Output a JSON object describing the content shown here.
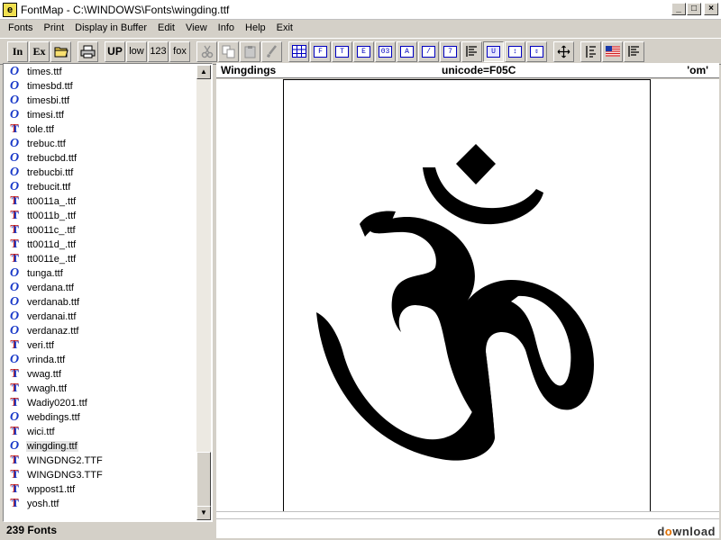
{
  "window": {
    "title": "FontMap - C:\\WINDOWS\\Fonts\\wingding.ttf",
    "app_icon_letter": "e",
    "controls": {
      "minimize": "_",
      "maximize": "□",
      "close": "×"
    }
  },
  "menu": [
    "Fonts",
    "Print",
    "Display in Buffer",
    "Edit",
    "View",
    "Info",
    "Help",
    "Exit"
  ],
  "toolbar": {
    "in_label": "In",
    "ex_label": "Ex",
    "up_label": "UP",
    "low_label": "low",
    "num_label": "123",
    "fox_label": "fox"
  },
  "font_list": [
    {
      "name": "times.ttf",
      "type": "otf"
    },
    {
      "name": "timesbd.ttf",
      "type": "otf"
    },
    {
      "name": "timesbi.ttf",
      "type": "otf"
    },
    {
      "name": "timesi.ttf",
      "type": "otf"
    },
    {
      "name": "tole.ttf",
      "type": "ttf"
    },
    {
      "name": "trebuc.ttf",
      "type": "otf"
    },
    {
      "name": "trebucbd.ttf",
      "type": "otf"
    },
    {
      "name": "trebucbi.ttf",
      "type": "otf"
    },
    {
      "name": "trebucit.ttf",
      "type": "otf"
    },
    {
      "name": "tt0011a_.ttf",
      "type": "ttf"
    },
    {
      "name": "tt0011b_.ttf",
      "type": "ttf"
    },
    {
      "name": "tt0011c_.ttf",
      "type": "ttf"
    },
    {
      "name": "tt0011d_.ttf",
      "type": "ttf"
    },
    {
      "name": "tt0011e_.ttf",
      "type": "ttf"
    },
    {
      "name": "tunga.ttf",
      "type": "otf"
    },
    {
      "name": "verdana.ttf",
      "type": "otf"
    },
    {
      "name": "verdanab.ttf",
      "type": "otf"
    },
    {
      "name": "verdanai.ttf",
      "type": "otf"
    },
    {
      "name": "verdanaz.ttf",
      "type": "otf"
    },
    {
      "name": "veri.ttf",
      "type": "ttf"
    },
    {
      "name": "vrinda.ttf",
      "type": "otf"
    },
    {
      "name": "vwag.ttf",
      "type": "ttf"
    },
    {
      "name": "vwagh.ttf",
      "type": "ttf"
    },
    {
      "name": "Wadiy0201.ttf",
      "type": "ttf"
    },
    {
      "name": "webdings.ttf",
      "type": "otf"
    },
    {
      "name": "wici.ttf",
      "type": "ttf"
    },
    {
      "name": "wingding.ttf",
      "type": "otf",
      "selected": true
    },
    {
      "name": "WINGDNG2.TTF",
      "type": "ttf"
    },
    {
      "name": "WINGDNG3.TTF",
      "type": "ttf"
    },
    {
      "name": "wppost1.ttf",
      "type": "ttf"
    },
    {
      "name": "yosh.ttf",
      "type": "ttf"
    }
  ],
  "status": {
    "font_count": "239 Fonts"
  },
  "glyph_header": {
    "font_name": "Wingdings",
    "unicode": "unicode=F05C",
    "glyph_name": "'om'"
  },
  "watermark": {
    "prefix": "d",
    "o": "o",
    "suffix": "wnload"
  }
}
